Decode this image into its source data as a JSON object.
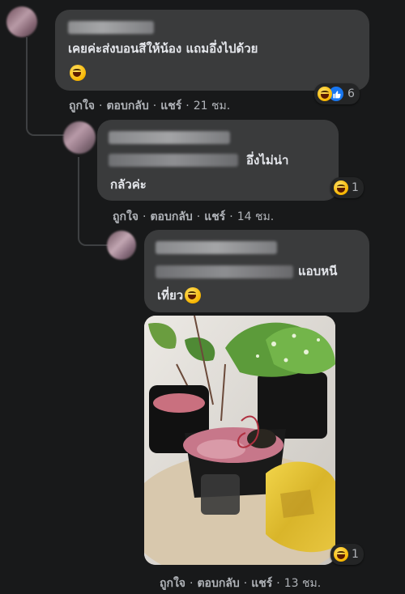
{
  "comments": [
    {
      "text_line1": "เคยค่ะส่งบอนสีให้น้อง แถมอึ่งไปด้วย",
      "text_line2": "",
      "reaction_count": "6",
      "actions": {
        "like": "ถูกใจ",
        "reply": "ตอบกลับ",
        "share": "แชร์",
        "time": "21 ชม."
      }
    },
    {
      "text_line1": "อึ่งไม่น่า",
      "text_line2": "กลัวค่ะ",
      "reaction_count": "1",
      "actions": {
        "like": "ถูกใจ",
        "reply": "ตอบกลับ",
        "share": "แชร์",
        "time": "14 ชม."
      }
    },
    {
      "text_line1": "แอบหนี",
      "text_line2": "เที่ยว",
      "reaction_count": "1",
      "photo_reaction_count": "1",
      "actions": {
        "like": "ถูกใจ",
        "reply": "ตอบกลับ",
        "share": "แชร์",
        "time": "13 ชม."
      }
    }
  ],
  "separator": "·",
  "colors": {
    "background": "#18191a",
    "bubble": "#3a3b3c",
    "text": "#e4e6eb",
    "muted": "#b0b3b8",
    "like_blue": "#1877f2"
  },
  "icons": [
    "haha-emoji-icon",
    "like-emoji-icon"
  ]
}
